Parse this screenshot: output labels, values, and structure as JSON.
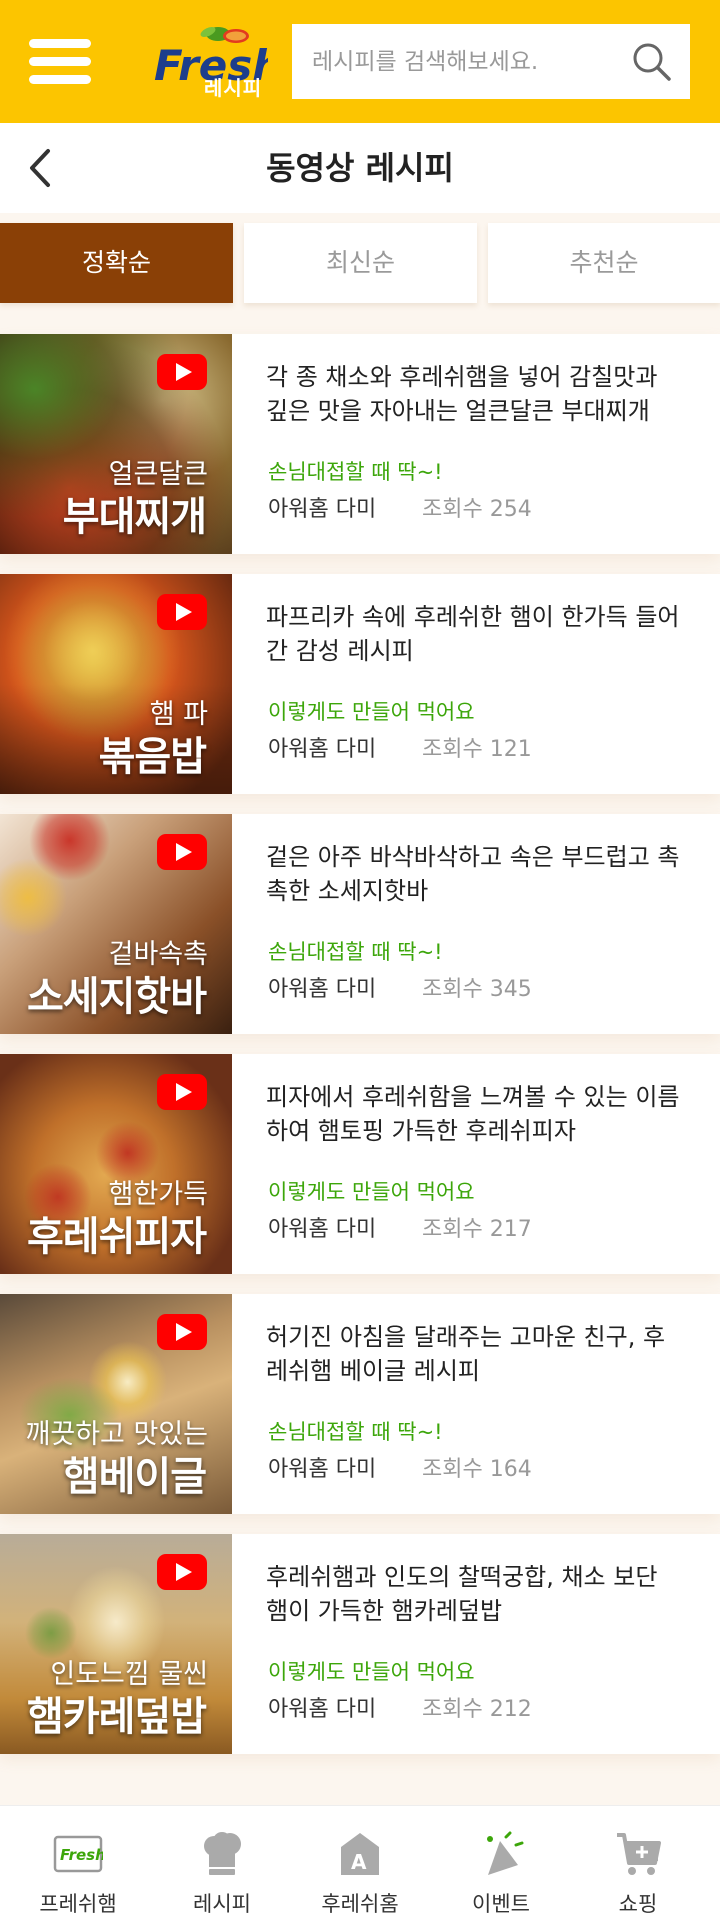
{
  "header": {
    "logo_sub": "레시피",
    "search_placeholder": "레시피를 검색해보세요."
  },
  "titlebar": {
    "title": "동영상 레시피"
  },
  "tabs": [
    {
      "label": "정확순",
      "active": true
    },
    {
      "label": "최신순",
      "active": false
    },
    {
      "label": "추천순",
      "active": false
    }
  ],
  "recipes": [
    {
      "thumb_sub": "얼큰달큰",
      "thumb_main": "부대찌개",
      "desc": "각 종 채소와 후레쉬햄을 넣어 감칠맛과 깊은 맛을 자아내는 얼큰달큰 부대찌개",
      "tag": "손님대접할 때 딱~!",
      "author": "아워홈 다미",
      "views": "조회수 254"
    },
    {
      "thumb_sub": "햄 파",
      "thumb_main": "볶음밥",
      "desc": "파프리카 속에 후레쉬한 햄이 한가득 들어간 감성 레시피",
      "tag": "이렇게도 만들어 먹어요",
      "author": "아워홈 다미",
      "views": "조회수 121"
    },
    {
      "thumb_sub": "겉바속촉",
      "thumb_main": "소세지핫바",
      "desc": "겉은 아주 바삭바삭하고 속은 부드럽고 촉촉한 소세지핫바",
      "tag": "손님대접할 때 딱~!",
      "author": "아워홈 다미",
      "views": "조회수 345"
    },
    {
      "thumb_sub": "햄한가득",
      "thumb_main": "후레쉬피자",
      "desc": "피자에서 후레쉬함을 느껴볼 수 있는 이름하여 햄토핑 가득한 후레쉬피자",
      "tag": "이렇게도 만들어 먹어요",
      "author": "아워홈 다미",
      "views": "조회수 217"
    },
    {
      "thumb_sub": "깨끗하고 맛있는",
      "thumb_main": "햄베이글",
      "desc": "허기진 아침을 달래주는 고마운 친구, 후레쉬햄 베이글 레시피",
      "tag": "손님대접할 때 딱~!",
      "author": "아워홈 다미",
      "views": "조회수 164"
    },
    {
      "thumb_sub": "인도느낌 물씬",
      "thumb_main": "햄카레덮밥",
      "desc": "후레쉬햄과 인도의 찰떡궁합, 채소 보단 햄이 가득한 햄카레덮밥",
      "tag": "이렇게도 만들어 먹어요",
      "author": "아워홈 다미",
      "views": "조회수 212"
    }
  ],
  "bottom_nav": [
    {
      "label": "프레쉬햄",
      "icon": "fresh-logo-icon"
    },
    {
      "label": "레시피",
      "icon": "chef-hat-icon"
    },
    {
      "label": "후레쉬홈",
      "icon": "home-icon"
    },
    {
      "label": "이벤트",
      "icon": "party-icon"
    },
    {
      "label": "쇼핑",
      "icon": "cart-icon"
    }
  ],
  "colors": {
    "brand_yellow": "#fcc500",
    "tab_active": "#8a4006",
    "tag_green": "#3ca60a",
    "youtube_red": "#ff0000"
  }
}
